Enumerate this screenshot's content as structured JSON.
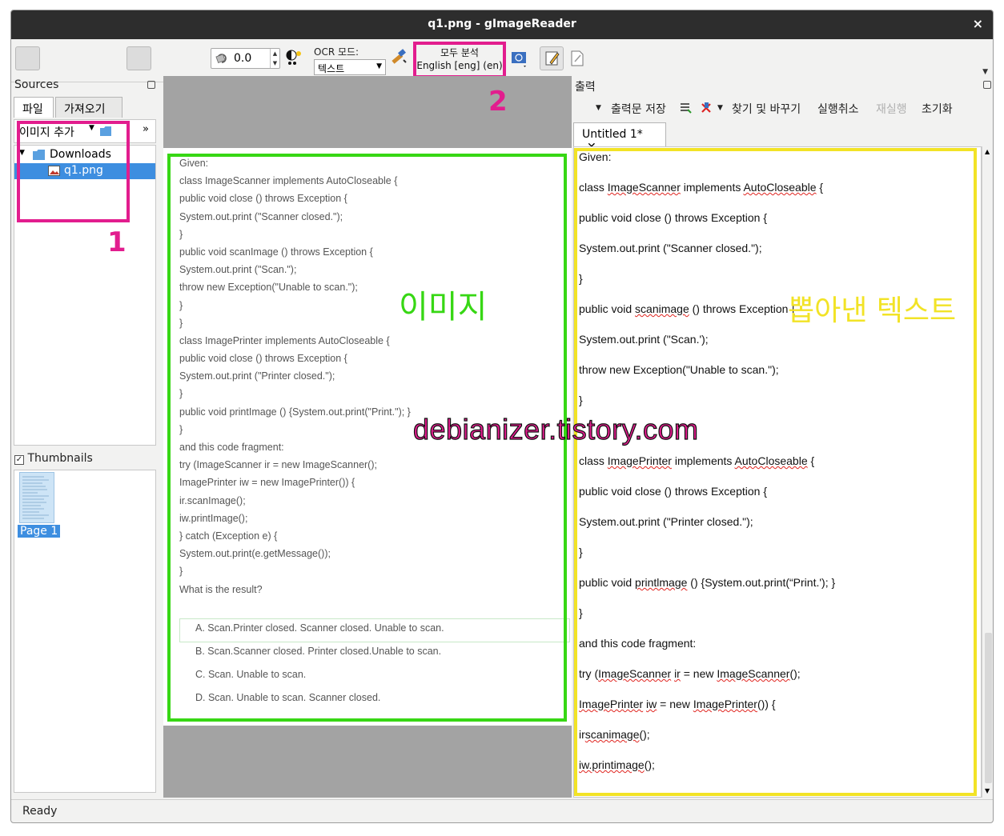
{
  "window": {
    "title": "q1.png - gImageReader",
    "close_glyph": "×"
  },
  "toolbar": {
    "rotation_value": "0.0",
    "ocr_mode_label": "OCR 모드:",
    "ocr_mode_value": "텍스트",
    "recognize_label": "모두 분석",
    "recognize_language": "English [eng] (en)"
  },
  "sources": {
    "header": "Sources",
    "tabs": [
      "파일",
      "가져오기"
    ],
    "add_image_label": "이미지 추가",
    "tree": {
      "folder": "Downloads",
      "file": "q1.png"
    },
    "thumbnails_label": "Thumbnails",
    "thumbnail_page": "Page 1"
  },
  "image": {
    "lines": [
      "Given:",
      "class ImageScanner implements AutoCloseable {",
      "public void close () throws Exception {",
      "System.out.print (\"Scanner closed.\");",
      "}",
      "public void scanImage () throws Exception {",
      "System.out.print (\"Scan.\");",
      "throw new Exception(\"Unable to scan.\");",
      "}",
      "}",
      "class ImagePrinter implements AutoCloseable {",
      "public void close () throws Exception {",
      "System.out.print (\"Printer closed.\");",
      "}",
      "public void printImage () {System.out.print(\"Print.\"); }",
      "}",
      "and this code fragment:",
      "try (ImageScanner ir = new ImageScanner();",
      "ImagePrinter iw = new ImagePrinter()) {",
      "ir.scanImage();",
      "iw.printImage();",
      "} catch (Exception e) {",
      "System.out.print(e.getMessage());",
      "}",
      "What is the result?"
    ],
    "answers": [
      "A. Scan.Printer closed. Scanner closed. Unable to scan.",
      "B. Scan.Scanner closed. Printer closed.Unable to scan.",
      "C. Scan. Unable to scan.",
      "D. Scan. Unable to scan. Scanner closed."
    ]
  },
  "output": {
    "header": "출력",
    "toolbar": {
      "save": "출력문 저장",
      "find_replace": "찾기 및 바꾸기",
      "undo": "실행취소",
      "redo": "재실행",
      "reset": "초기화"
    },
    "doc_tab": "Untitled 1*",
    "doc_tab_close": "✕",
    "lines": [
      "Given:",
      "class ImageScanner implements AutoCloseable {",
      "public void close () throws Exception {",
      "System.out.print (\"Scanner closed.\");",
      "}",
      "public void scanimage () throws Exception {",
      "System.out.print (\"Scan.');",
      "throw new Exception(\"Unable to scan.\");",
      "}",
      "",
      "class ImagePrinter implements AutoCloseable {",
      "public void close () throws Exception {",
      "System.out.print (\"Printer closed.\");",
      "}",
      "public void printlmage () {System.out.print(“Print.'); }",
      "}",
      "and this code fragment:",
      "try (ImageScanner ir = new ImageScanner();",
      "ImagePrinter iw = new ImagePrinter()) {",
      "irscanimage();",
      "iw.printimage();"
    ]
  },
  "annotations": {
    "label_1": "1",
    "label_2": "2",
    "image_label": "이미지",
    "text_label": "뽑아낸 텍스트",
    "watermark": "debianizer.tistory.com"
  },
  "status": "Ready",
  "colors": {
    "accent_pink": "#e21d8e",
    "accent_green": "#37d714",
    "accent_yellow": "#f2e326",
    "selection_blue": "#3d8ee0"
  }
}
